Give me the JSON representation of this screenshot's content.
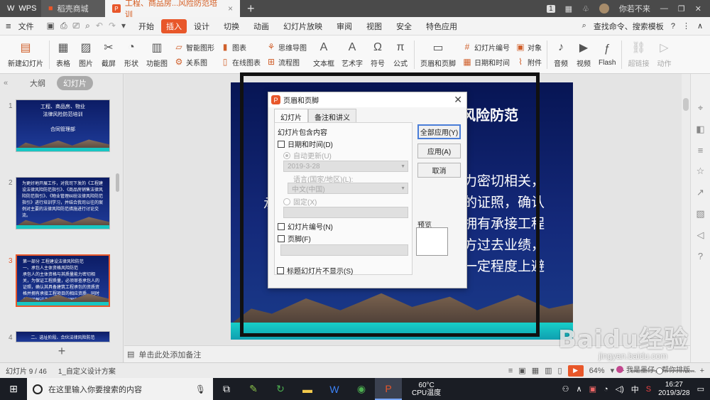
{
  "titlebar": {
    "tabs": [
      {
        "label": "WPS",
        "icon": "wps-logo-icon"
      },
      {
        "label": "稻壳商城",
        "icon": "store-icon"
      },
      {
        "label": "工程、商品房...风险防范培训",
        "icon": "presentation-icon"
      }
    ],
    "page_count": "1",
    "user": "你若不来"
  },
  "menubar": {
    "file_label": "文件",
    "items": [
      "开始",
      "插入",
      "设计",
      "切换",
      "动画",
      "幻灯片放映",
      "审阅",
      "视图",
      "安全",
      "特色应用"
    ],
    "active_index": 1,
    "search_label": "查找命令、搜索模板"
  },
  "ribbon": {
    "groups": [
      {
        "label": "新建幻灯片",
        "icon": "new-slide-icon"
      },
      {
        "label": "表格",
        "icon": "table-icon"
      },
      {
        "label": "图片",
        "icon": "picture-icon"
      },
      {
        "label": "截屏",
        "icon": "screenshot-icon"
      },
      {
        "label": "形状",
        "icon": "shape-icon"
      },
      {
        "label": "功能图",
        "icon": "chart-icon"
      }
    ],
    "col1": [
      "智能图形",
      "关系图"
    ],
    "col2": [
      "图表",
      "在线图表"
    ],
    "col3": [
      "思维导图",
      "流程图"
    ],
    "groups2": [
      {
        "label": "文本框",
        "icon": "textbox-icon"
      },
      {
        "label": "艺术字",
        "icon": "wordart-icon"
      },
      {
        "label": "符号",
        "icon": "omega-icon"
      },
      {
        "label": "公式",
        "icon": "pi-icon"
      },
      {
        "label": "页眉和页脚",
        "icon": "header-footer-icon"
      }
    ],
    "col4": [
      "幻灯片编号",
      "日期和时间"
    ],
    "col5": [
      "对象",
      "附件"
    ],
    "groups3": [
      {
        "label": "音频",
        "icon": "audio-icon"
      },
      {
        "label": "视频",
        "icon": "video-icon"
      },
      {
        "label": "Flash",
        "icon": "flash-icon"
      },
      {
        "label": "超链接",
        "icon": "link-icon"
      },
      {
        "label": "动作",
        "icon": "action-icon"
      }
    ]
  },
  "left_pane": {
    "tabs": [
      "大纲",
      "幻灯片"
    ],
    "slides": [
      {
        "num": "1",
        "text": "工程、商品房、物业\n法律风险防范培训\n\n合同管理部"
      },
      {
        "num": "2",
        "text": "为更好地开展工作，对我司下发的《工程建设法律风险防范指引》、《商品房销售法律风险防范指引》、《物业管理纠纷法律风险防范指引》进行培训学习，并结合我司以往的案例对主要的法律风险防范措施进行讨论交流。"
      },
      {
        "num": "3",
        "text": "第一部分  工程建设法律风险防范\n一、承包人主体资格风险防范\n承包人的主体资格与其质量能力密切相关，为保证工程质量，必须审查承包人的证照，确认其具备建筑工程承包的资质资格并拥有承接工程项目的相应资质。同时考察了解过去的业绩，与国内外优秀的企业合作，能在一定程度上避免主体资格方面的风险。"
      },
      {
        "num": "4",
        "text": "二、选址阶段、合伙法律风险防范"
      }
    ],
    "selected_index": 2
  },
  "slide": {
    "title_fragment": "风险防范",
    "lines": [
      "力密切相关，",
      "的证照，确认",
      "拥有承接工程",
      "方过去业绩，",
      "一定程度上避"
    ],
    "left_fragment": "承"
  },
  "notes_placeholder": "单击此处添加备注",
  "dialog": {
    "title": "页眉和页脚",
    "tabs": [
      "幻灯片",
      "备注和讲义"
    ],
    "group_label": "幻灯片包含内容",
    "date_time_label": "日期和时间(D)",
    "auto_update_label": "自动更新(U)",
    "date_value": "2019-3-28",
    "language_label": "语言(国家/地区)(L):",
    "language_value": "中文(中国)",
    "fixed_label": "固定(X)",
    "slide_number_label": "幻灯片编号(N)",
    "footer_label": "页脚(F)",
    "hide_on_title_label": "标题幻灯片不显示(S)",
    "apply_all_button": "全部应用(Y)",
    "apply_button": "应用(A)",
    "cancel_button": "取消",
    "preview_label": "预览"
  },
  "statusbar": {
    "slide_info": "幻灯片 9 / 46",
    "theme": "1_自定义设计方案",
    "zoom": "64%",
    "zoom_fraction": 0.45
  },
  "bubble_text": "我是墨仔，帮你排版...",
  "watermark": {
    "main": "Baidu经验",
    "sub": "jingyan.baidu.com"
  },
  "taskbar": {
    "search_placeholder": "在这里输入你要搜索的内容",
    "cpu_temp": "60°C",
    "cpu_label": "CPU温度",
    "ime": "中",
    "time": "16:27",
    "date": "2019/3/28"
  }
}
